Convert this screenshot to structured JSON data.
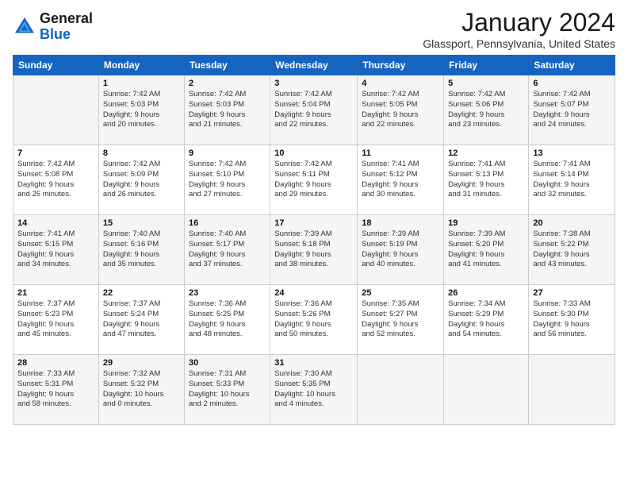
{
  "header": {
    "logo_line1": "General",
    "logo_line2": "Blue",
    "month": "January 2024",
    "location": "Glassport, Pennsylvania, United States"
  },
  "weekdays": [
    "Sunday",
    "Monday",
    "Tuesday",
    "Wednesday",
    "Thursday",
    "Friday",
    "Saturday"
  ],
  "weeks": [
    [
      {
        "day": "",
        "info": ""
      },
      {
        "day": "1",
        "info": "Sunrise: 7:42 AM\nSunset: 5:03 PM\nDaylight: 9 hours\nand 20 minutes."
      },
      {
        "day": "2",
        "info": "Sunrise: 7:42 AM\nSunset: 5:03 PM\nDaylight: 9 hours\nand 21 minutes."
      },
      {
        "day": "3",
        "info": "Sunrise: 7:42 AM\nSunset: 5:04 PM\nDaylight: 9 hours\nand 22 minutes."
      },
      {
        "day": "4",
        "info": "Sunrise: 7:42 AM\nSunset: 5:05 PM\nDaylight: 9 hours\nand 22 minutes."
      },
      {
        "day": "5",
        "info": "Sunrise: 7:42 AM\nSunset: 5:06 PM\nDaylight: 9 hours\nand 23 minutes."
      },
      {
        "day": "6",
        "info": "Sunrise: 7:42 AM\nSunset: 5:07 PM\nDaylight: 9 hours\nand 24 minutes."
      }
    ],
    [
      {
        "day": "7",
        "info": "Sunrise: 7:42 AM\nSunset: 5:08 PM\nDaylight: 9 hours\nand 25 minutes."
      },
      {
        "day": "8",
        "info": "Sunrise: 7:42 AM\nSunset: 5:09 PM\nDaylight: 9 hours\nand 26 minutes."
      },
      {
        "day": "9",
        "info": "Sunrise: 7:42 AM\nSunset: 5:10 PM\nDaylight: 9 hours\nand 27 minutes."
      },
      {
        "day": "10",
        "info": "Sunrise: 7:42 AM\nSunset: 5:11 PM\nDaylight: 9 hours\nand 29 minutes."
      },
      {
        "day": "11",
        "info": "Sunrise: 7:41 AM\nSunset: 5:12 PM\nDaylight: 9 hours\nand 30 minutes."
      },
      {
        "day": "12",
        "info": "Sunrise: 7:41 AM\nSunset: 5:13 PM\nDaylight: 9 hours\nand 31 minutes."
      },
      {
        "day": "13",
        "info": "Sunrise: 7:41 AM\nSunset: 5:14 PM\nDaylight: 9 hours\nand 32 minutes."
      }
    ],
    [
      {
        "day": "14",
        "info": "Sunrise: 7:41 AM\nSunset: 5:15 PM\nDaylight: 9 hours\nand 34 minutes."
      },
      {
        "day": "15",
        "info": "Sunrise: 7:40 AM\nSunset: 5:16 PM\nDaylight: 9 hours\nand 35 minutes."
      },
      {
        "day": "16",
        "info": "Sunrise: 7:40 AM\nSunset: 5:17 PM\nDaylight: 9 hours\nand 37 minutes."
      },
      {
        "day": "17",
        "info": "Sunrise: 7:39 AM\nSunset: 5:18 PM\nDaylight: 9 hours\nand 38 minutes."
      },
      {
        "day": "18",
        "info": "Sunrise: 7:39 AM\nSunset: 5:19 PM\nDaylight: 9 hours\nand 40 minutes."
      },
      {
        "day": "19",
        "info": "Sunrise: 7:39 AM\nSunset: 5:20 PM\nDaylight: 9 hours\nand 41 minutes."
      },
      {
        "day": "20",
        "info": "Sunrise: 7:38 AM\nSunset: 5:22 PM\nDaylight: 9 hours\nand 43 minutes."
      }
    ],
    [
      {
        "day": "21",
        "info": "Sunrise: 7:37 AM\nSunset: 5:23 PM\nDaylight: 9 hours\nand 45 minutes."
      },
      {
        "day": "22",
        "info": "Sunrise: 7:37 AM\nSunset: 5:24 PM\nDaylight: 9 hours\nand 47 minutes."
      },
      {
        "day": "23",
        "info": "Sunrise: 7:36 AM\nSunset: 5:25 PM\nDaylight: 9 hours\nand 48 minutes."
      },
      {
        "day": "24",
        "info": "Sunrise: 7:36 AM\nSunset: 5:26 PM\nDaylight: 9 hours\nand 50 minutes."
      },
      {
        "day": "25",
        "info": "Sunrise: 7:35 AM\nSunset: 5:27 PM\nDaylight: 9 hours\nand 52 minutes."
      },
      {
        "day": "26",
        "info": "Sunrise: 7:34 AM\nSunset: 5:29 PM\nDaylight: 9 hours\nand 54 minutes."
      },
      {
        "day": "27",
        "info": "Sunrise: 7:33 AM\nSunset: 5:30 PM\nDaylight: 9 hours\nand 56 minutes."
      }
    ],
    [
      {
        "day": "28",
        "info": "Sunrise: 7:33 AM\nSunset: 5:31 PM\nDaylight: 9 hours\nand 58 minutes."
      },
      {
        "day": "29",
        "info": "Sunrise: 7:32 AM\nSunset: 5:32 PM\nDaylight: 10 hours\nand 0 minutes."
      },
      {
        "day": "30",
        "info": "Sunrise: 7:31 AM\nSunset: 5:33 PM\nDaylight: 10 hours\nand 2 minutes."
      },
      {
        "day": "31",
        "info": "Sunrise: 7:30 AM\nSunset: 5:35 PM\nDaylight: 10 hours\nand 4 minutes."
      },
      {
        "day": "",
        "info": ""
      },
      {
        "day": "",
        "info": ""
      },
      {
        "day": "",
        "info": ""
      }
    ]
  ]
}
